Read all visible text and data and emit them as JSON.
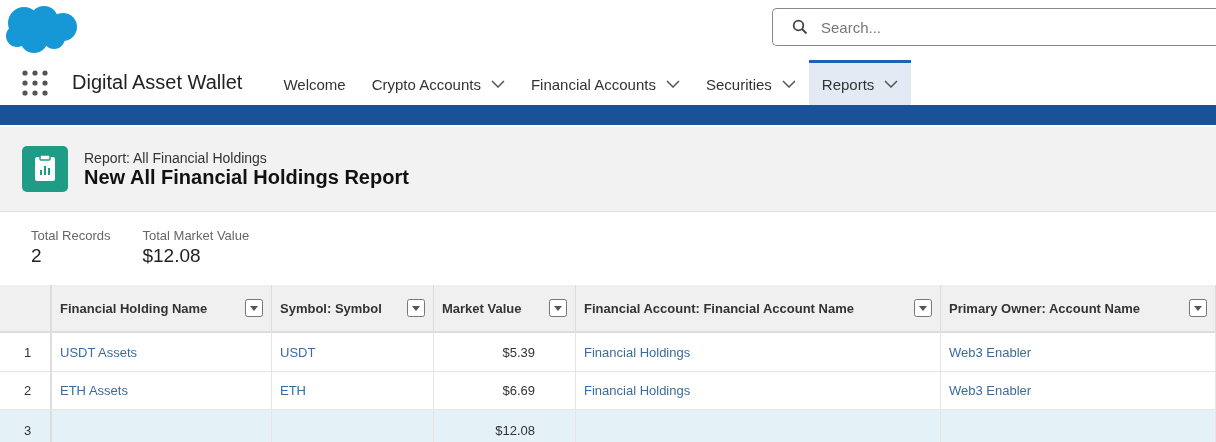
{
  "search": {
    "placeholder": "Search..."
  },
  "app": {
    "title": "Digital Asset Wallet"
  },
  "tabs": [
    {
      "label": "Welcome",
      "dropdown": false,
      "selected": false
    },
    {
      "label": "Crypto Accounts",
      "dropdown": true,
      "selected": false
    },
    {
      "label": "Financial Accounts",
      "dropdown": true,
      "selected": false
    },
    {
      "label": "Securities",
      "dropdown": true,
      "selected": false
    },
    {
      "label": "Reports",
      "dropdown": true,
      "selected": true
    }
  ],
  "report": {
    "type_label": "Report: All Financial Holdings",
    "title": "New All Financial Holdings Report"
  },
  "summary": [
    {
      "label": "Total Records",
      "value": "2"
    },
    {
      "label": "Total Market Value",
      "value": "$12.08"
    }
  ],
  "table": {
    "columns": [
      {
        "label": "Financial Holding Name",
        "kind": "link"
      },
      {
        "label": "Symbol: Symbol",
        "kind": "link"
      },
      {
        "label": "Market Value",
        "kind": "currency"
      },
      {
        "label": "Financial Account: Financial Account Name",
        "kind": "link"
      },
      {
        "label": "Primary Owner: Account Name",
        "kind": "link"
      }
    ],
    "rows": [
      {
        "number": "1",
        "kind": "detail",
        "cells": [
          "USDT Assets",
          "USDT",
          "$5.39",
          "Financial Holdings",
          "Web3 Enabler"
        ]
      },
      {
        "number": "2",
        "kind": "detail",
        "cells": [
          "ETH Assets",
          "ETH",
          "$6.69",
          "Financial Holdings",
          "Web3 Enabler"
        ]
      },
      {
        "number": "3",
        "kind": "total",
        "cells": [
          null,
          null,
          "$12.08",
          null,
          null
        ]
      }
    ]
  }
}
